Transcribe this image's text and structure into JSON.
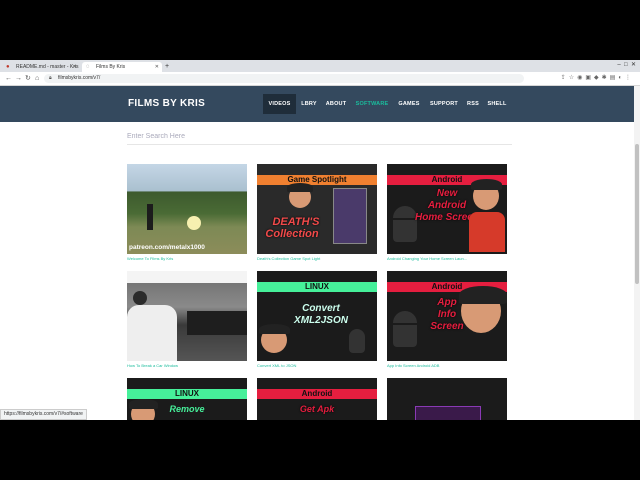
{
  "browser": {
    "tabs": [
      {
        "title": "README.md - master - Kris"
      },
      {
        "title": "Films By Kris"
      }
    ],
    "url": "filmsbykris.com/v7/",
    "status_url": "https://filmsbykris.com/v7/#software"
  },
  "site": {
    "brand": "FILMS BY KRIS",
    "nav": [
      "VIDEOS",
      "LBRY",
      "ABOUT",
      "SOFTWARE",
      "GAMES",
      "SUPPORT",
      "RSS",
      "SHELL"
    ],
    "search_placeholder": "Enter Search Here",
    "videos": [
      {
        "caption": "Welcome To Films By Kris",
        "overlay": "patreon.com/metalx1000"
      },
      {
        "caption": "Death's Collection Game Spot Light",
        "banner": "Game Spotlight",
        "text1": "DEATH'S",
        "text2": "Collection"
      },
      {
        "caption": "Android Changing Your Home Screen Laun...",
        "banner": "Android",
        "text1": "New",
        "text2": "Android",
        "text3": "Home Screen"
      },
      {
        "caption": "How To Break a Car Window"
      },
      {
        "caption": "Convert XML to JSON",
        "banner": "LINUX",
        "text1": "Convert",
        "text2": "XML2JSON"
      },
      {
        "caption": "App Info Screen Android ADB",
        "banner": "Android",
        "text1": "App",
        "text2": "Info",
        "text3": "Screen"
      },
      {
        "banner": "LINUX",
        "text1": "Remove"
      },
      {
        "banner": "Android",
        "text1": "Get Apk"
      },
      {}
    ]
  }
}
